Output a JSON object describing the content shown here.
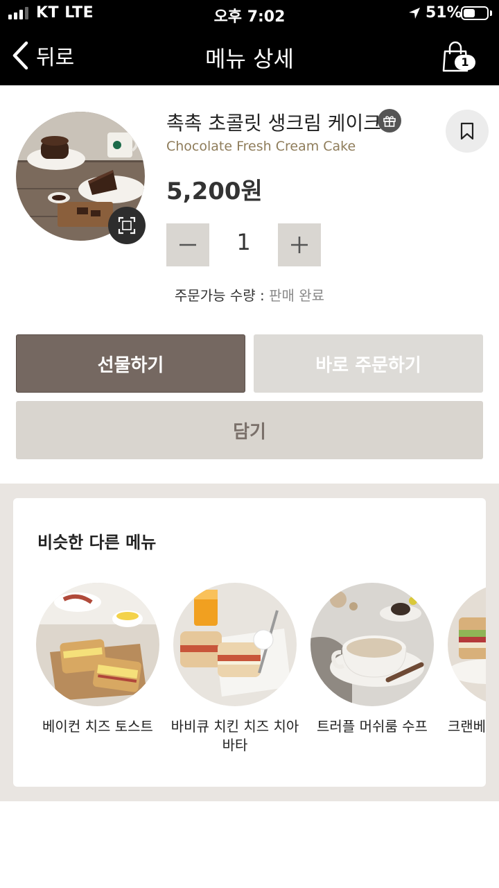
{
  "status_bar": {
    "carrier": "KT LTE",
    "time": "오후 7:02",
    "battery_percent": "51%",
    "battery_level": 0.51
  },
  "header": {
    "back_label": "뒤로",
    "title": "메뉴 상세",
    "cart_count": "1"
  },
  "product": {
    "name_ko": "촉촉 초콜릿 생크림 케이크",
    "name_en": "Chocolate Fresh Cream Cake",
    "price": "5,200원",
    "quantity": "1",
    "stock_label": "주문가능 수량 : ",
    "stock_status": "판매 완료"
  },
  "actions": {
    "gift": "선물하기",
    "order_now": "바로 주문하기",
    "add_to_cart": "담기"
  },
  "similar": {
    "title": "비슷한 다른 메뉴",
    "items": [
      {
        "name": "베이컨 치즈 토스트"
      },
      {
        "name": "바비큐 치킨 치즈 치아바타"
      },
      {
        "name": "트러플 머쉬룸 수프"
      },
      {
        "name": "크랜베리 치킨 샌드위치"
      }
    ]
  },
  "colors": {
    "header_bg": "#000000",
    "gift_button": "#756861",
    "order_button_disabled": "#dddbd7",
    "cart_button": "#d9d5cf",
    "english_name": "#8e7c5a",
    "section_bg": "#e9e5e1"
  },
  "icons": {
    "back": "chevron-left-icon",
    "cart": "shopping-bag-icon",
    "zoom": "expand-icon",
    "gift": "gift-icon",
    "bookmark": "bookmark-icon",
    "minus": "minus-icon",
    "plus": "plus-icon",
    "location": "location-arrow-icon"
  }
}
